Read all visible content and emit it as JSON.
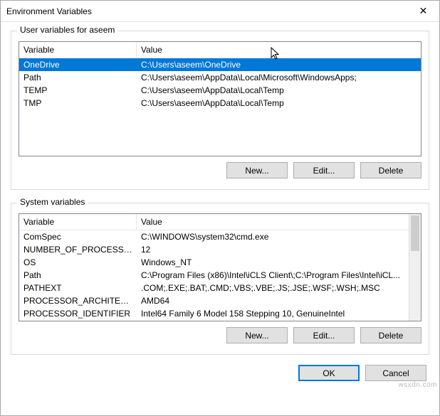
{
  "window": {
    "title": "Environment Variables",
    "close_icon": "✕"
  },
  "user_section": {
    "legend": "User variables for aseem",
    "columns": {
      "variable": "Variable",
      "value": "Value"
    },
    "rows": [
      {
        "variable": "OneDrive",
        "value": "C:\\Users\\aseem\\OneDrive",
        "selected": true
      },
      {
        "variable": "Path",
        "value": "C:\\Users\\aseem\\AppData\\Local\\Microsoft\\WindowsApps;",
        "selected": false
      },
      {
        "variable": "TEMP",
        "value": "C:\\Users\\aseem\\AppData\\Local\\Temp",
        "selected": false
      },
      {
        "variable": "TMP",
        "value": "C:\\Users\\aseem\\AppData\\Local\\Temp",
        "selected": false
      }
    ],
    "buttons": {
      "new": "New...",
      "edit": "Edit...",
      "delete": "Delete"
    }
  },
  "system_section": {
    "legend": "System variables",
    "columns": {
      "variable": "Variable",
      "value": "Value"
    },
    "rows": [
      {
        "variable": "ComSpec",
        "value": "C:\\WINDOWS\\system32\\cmd.exe"
      },
      {
        "variable": "NUMBER_OF_PROCESSORS",
        "value": "12"
      },
      {
        "variable": "OS",
        "value": "Windows_NT"
      },
      {
        "variable": "Path",
        "value": "C:\\Program Files (x86)\\Intel\\iCLS Client\\;C:\\Program Files\\Intel\\iCL..."
      },
      {
        "variable": "PATHEXT",
        "value": ".COM;.EXE;.BAT;.CMD;.VBS;.VBE;.JS;.JSE;.WSF;.WSH;.MSC"
      },
      {
        "variable": "PROCESSOR_ARCHITECTURE",
        "value": "AMD64"
      },
      {
        "variable": "PROCESSOR_IDENTIFIER",
        "value": "Intel64 Family 6 Model 158 Stepping 10, GenuineIntel"
      }
    ],
    "buttons": {
      "new": "New...",
      "edit": "Edit...",
      "delete": "Delete"
    }
  },
  "dialog_buttons": {
    "ok": "OK",
    "cancel": "Cancel"
  },
  "watermark": "wsxdn.com"
}
